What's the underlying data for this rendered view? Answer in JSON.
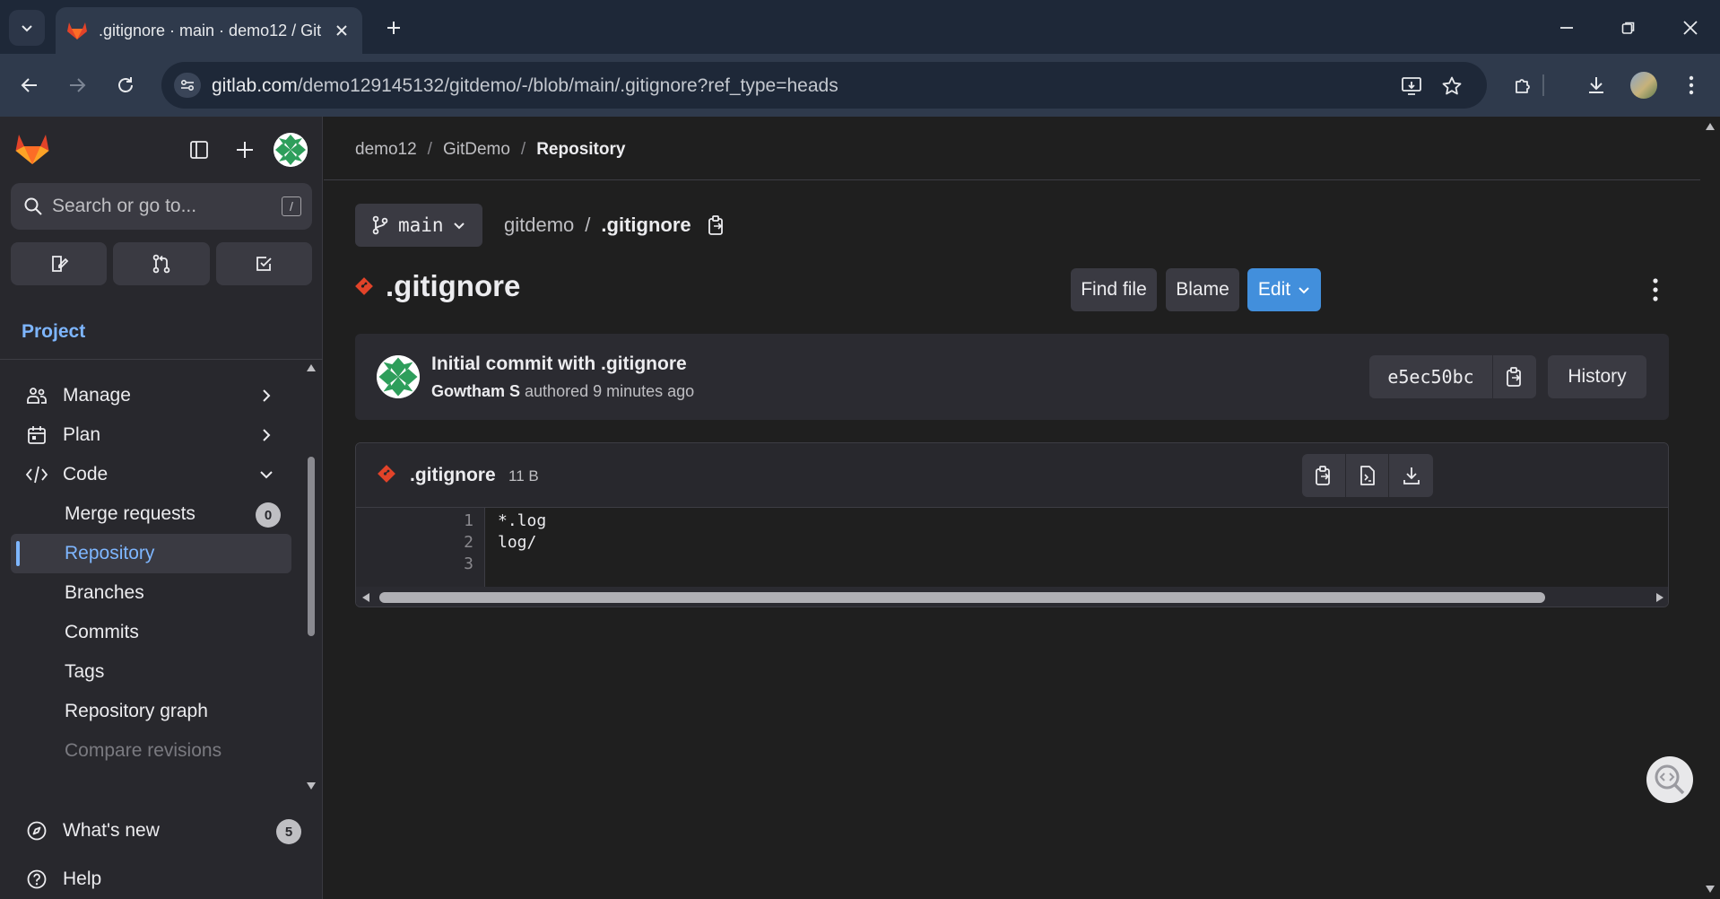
{
  "browser": {
    "tab_title": ".gitignore · main · demo12 / Git",
    "url_host": "gitlab.com",
    "url_path": "/demo129145132/gitdemo/-/blob/main/.gitignore?ref_type=heads"
  },
  "sidebar": {
    "search_placeholder": "Search or go to...",
    "slash_key": "/",
    "section_title": "Project",
    "items": [
      {
        "label": "Manage"
      },
      {
        "label": "Plan"
      },
      {
        "label": "Code"
      },
      {
        "label": "Merge requests",
        "badge": "0"
      },
      {
        "label": "Repository"
      },
      {
        "label": "Branches"
      },
      {
        "label": "Commits"
      },
      {
        "label": "Tags"
      },
      {
        "label": "Repository graph"
      },
      {
        "label": "Compare revisions"
      }
    ],
    "whats_new": {
      "label": "What's new",
      "badge": "5"
    },
    "help": {
      "label": "Help"
    }
  },
  "breadcrumbs": [
    "demo12",
    "GitDemo",
    "Repository"
  ],
  "branch": "main",
  "path": {
    "repo": "gitdemo",
    "file": ".gitignore"
  },
  "file_title": ".gitignore",
  "actions": {
    "find_file": "Find file",
    "blame": "Blame",
    "edit": "Edit"
  },
  "commit": {
    "title": "Initial commit with .gitignore",
    "author": "Gowtham S",
    "authored_text": "authored",
    "time": "9 minutes ago",
    "sha": "e5ec50bc",
    "history_label": "History"
  },
  "file": {
    "name": ".gitignore",
    "size": "11 B",
    "line_numbers": [
      "1",
      "2",
      "3"
    ],
    "lines": [
      "*.log",
      "log/",
      ""
    ]
  },
  "colors": {
    "accent": "#7eb6ff",
    "edit_button": "#428fdc",
    "gitlab_orange": "#e24329"
  }
}
